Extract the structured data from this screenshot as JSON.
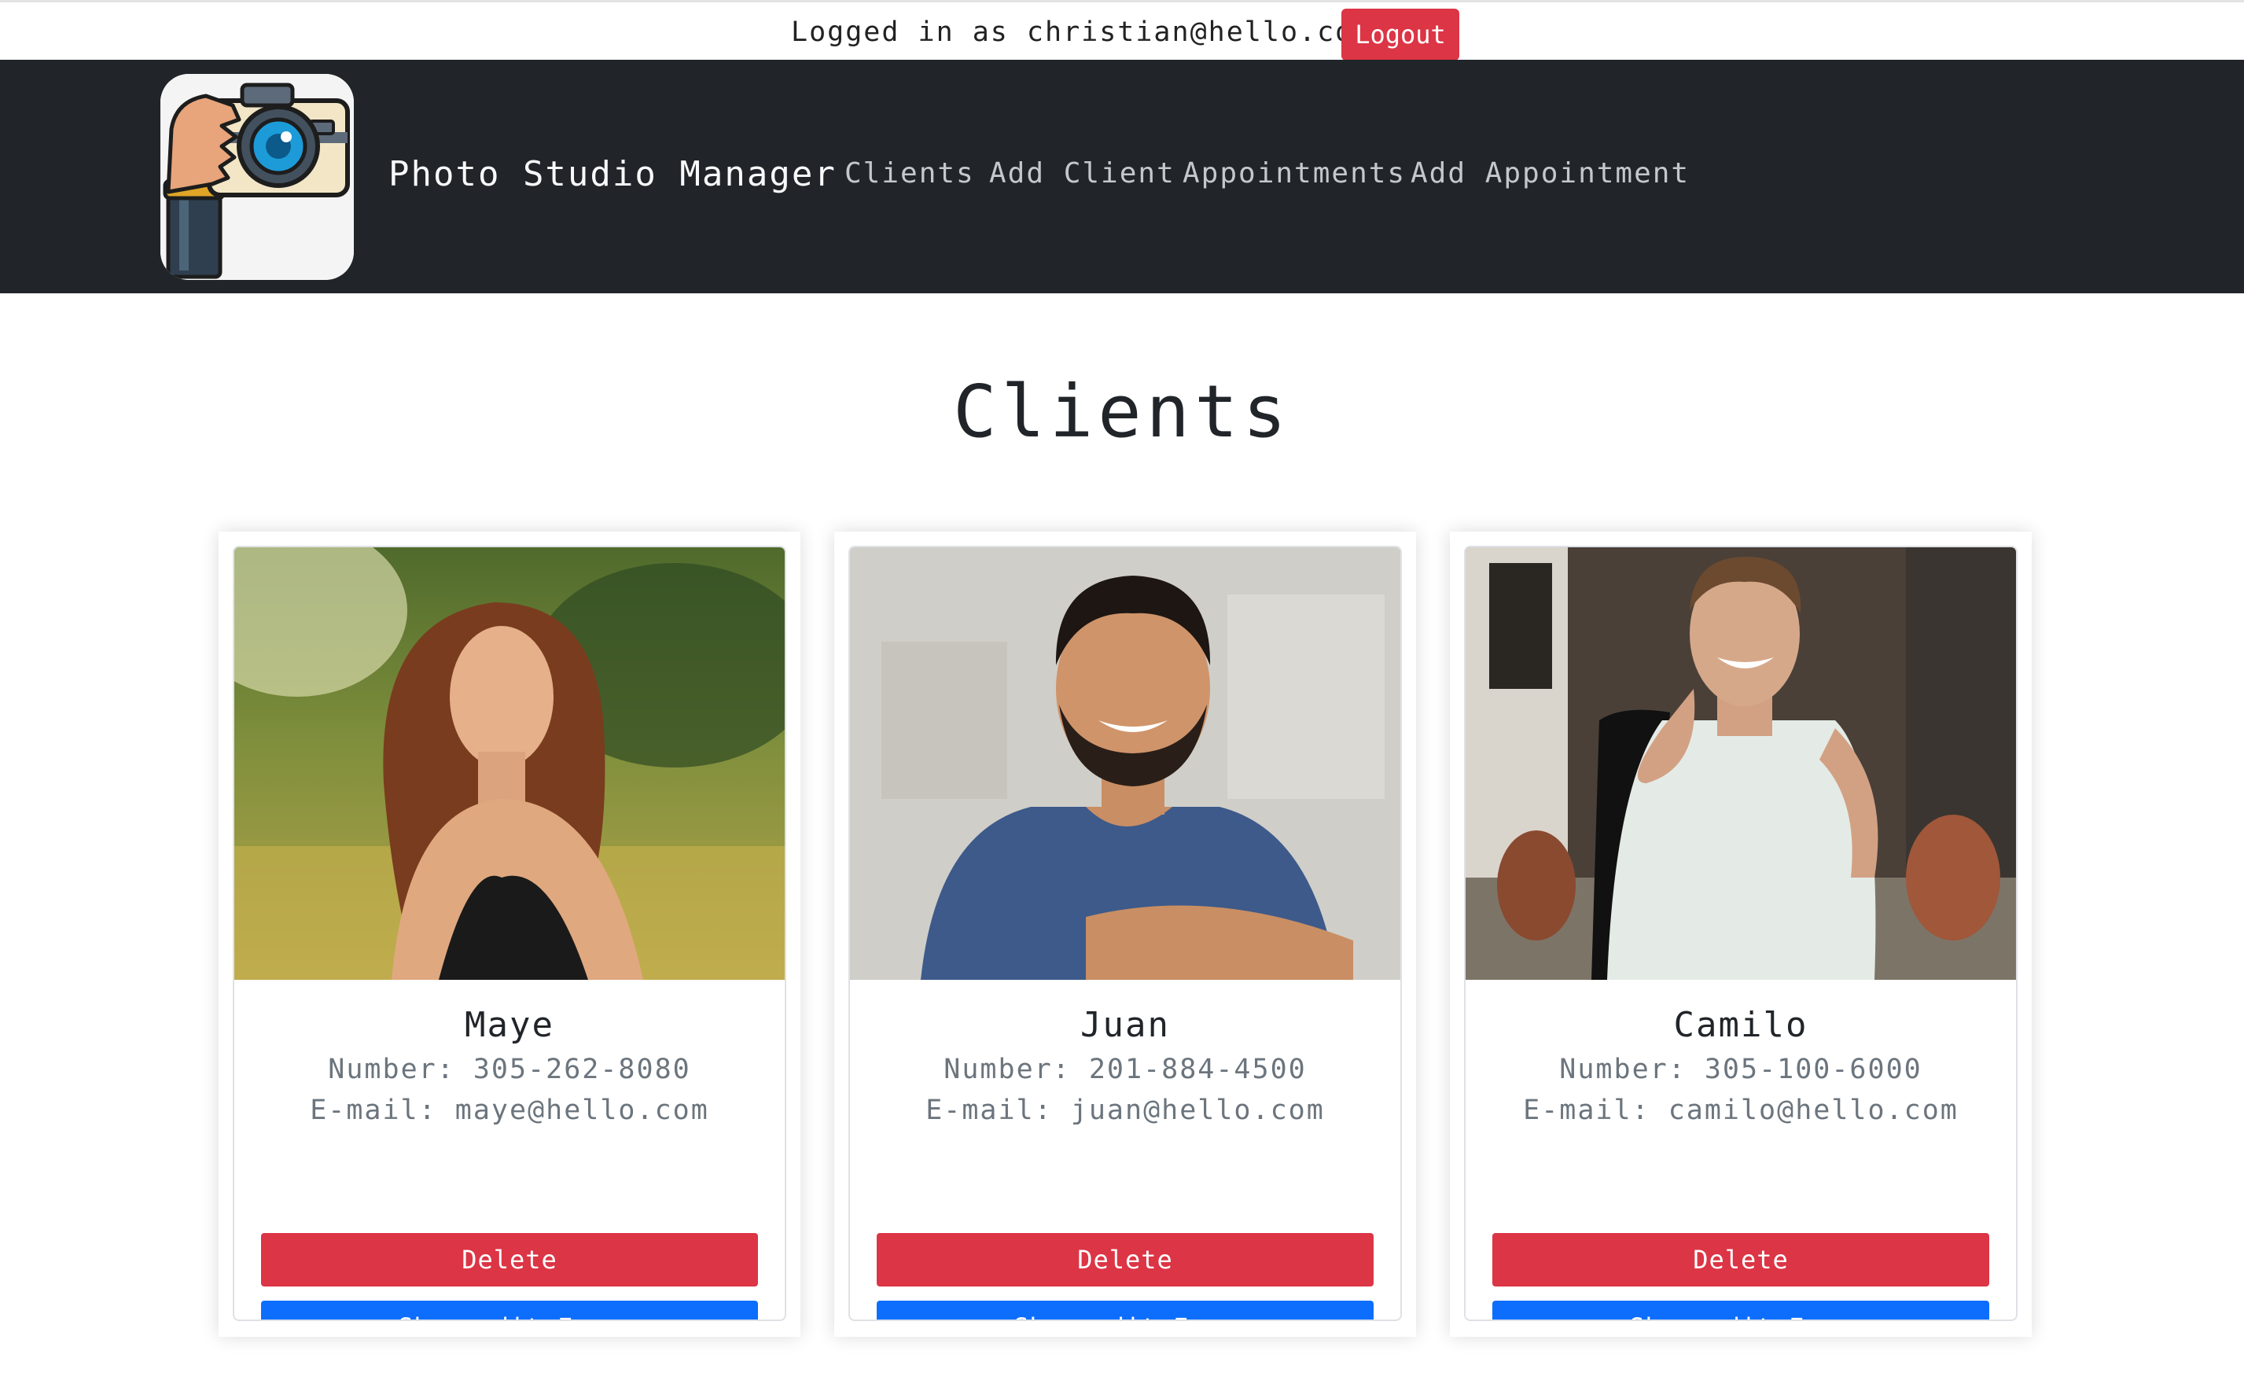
{
  "topbar": {
    "logged_in_text": "Logged in as christian@hello.com",
    "logout_label": "Logout"
  },
  "navbar": {
    "brand": "Photo Studio Manager",
    "logo_icon": "camera-hand-logo-icon",
    "links": [
      "Clients",
      "Add Client",
      "Appointments",
      "Add Appointment"
    ]
  },
  "page": {
    "title": "Clients"
  },
  "clients": [
    {
      "name": "Maye",
      "number": "Number: 305-262-8080",
      "email": "E-mail: maye@hello.com",
      "delete_label": "Delete",
      "edit_label": "Show edit Form"
    },
    {
      "name": "Juan",
      "number": "Number: 201-884-4500",
      "email": "E-mail: juan@hello.com",
      "delete_label": "Delete",
      "edit_label": "Show edit Form"
    },
    {
      "name": "Camilo",
      "number": "Number: 305-100-6000",
      "email": "E-mail: camilo@hello.com",
      "delete_label": "Delete",
      "edit_label": "Show edit Form"
    }
  ],
  "colors": {
    "navbar_bg": "#212529",
    "danger": "#dc3545",
    "primary": "#0d6efd",
    "muted_text": "#6c757d"
  }
}
